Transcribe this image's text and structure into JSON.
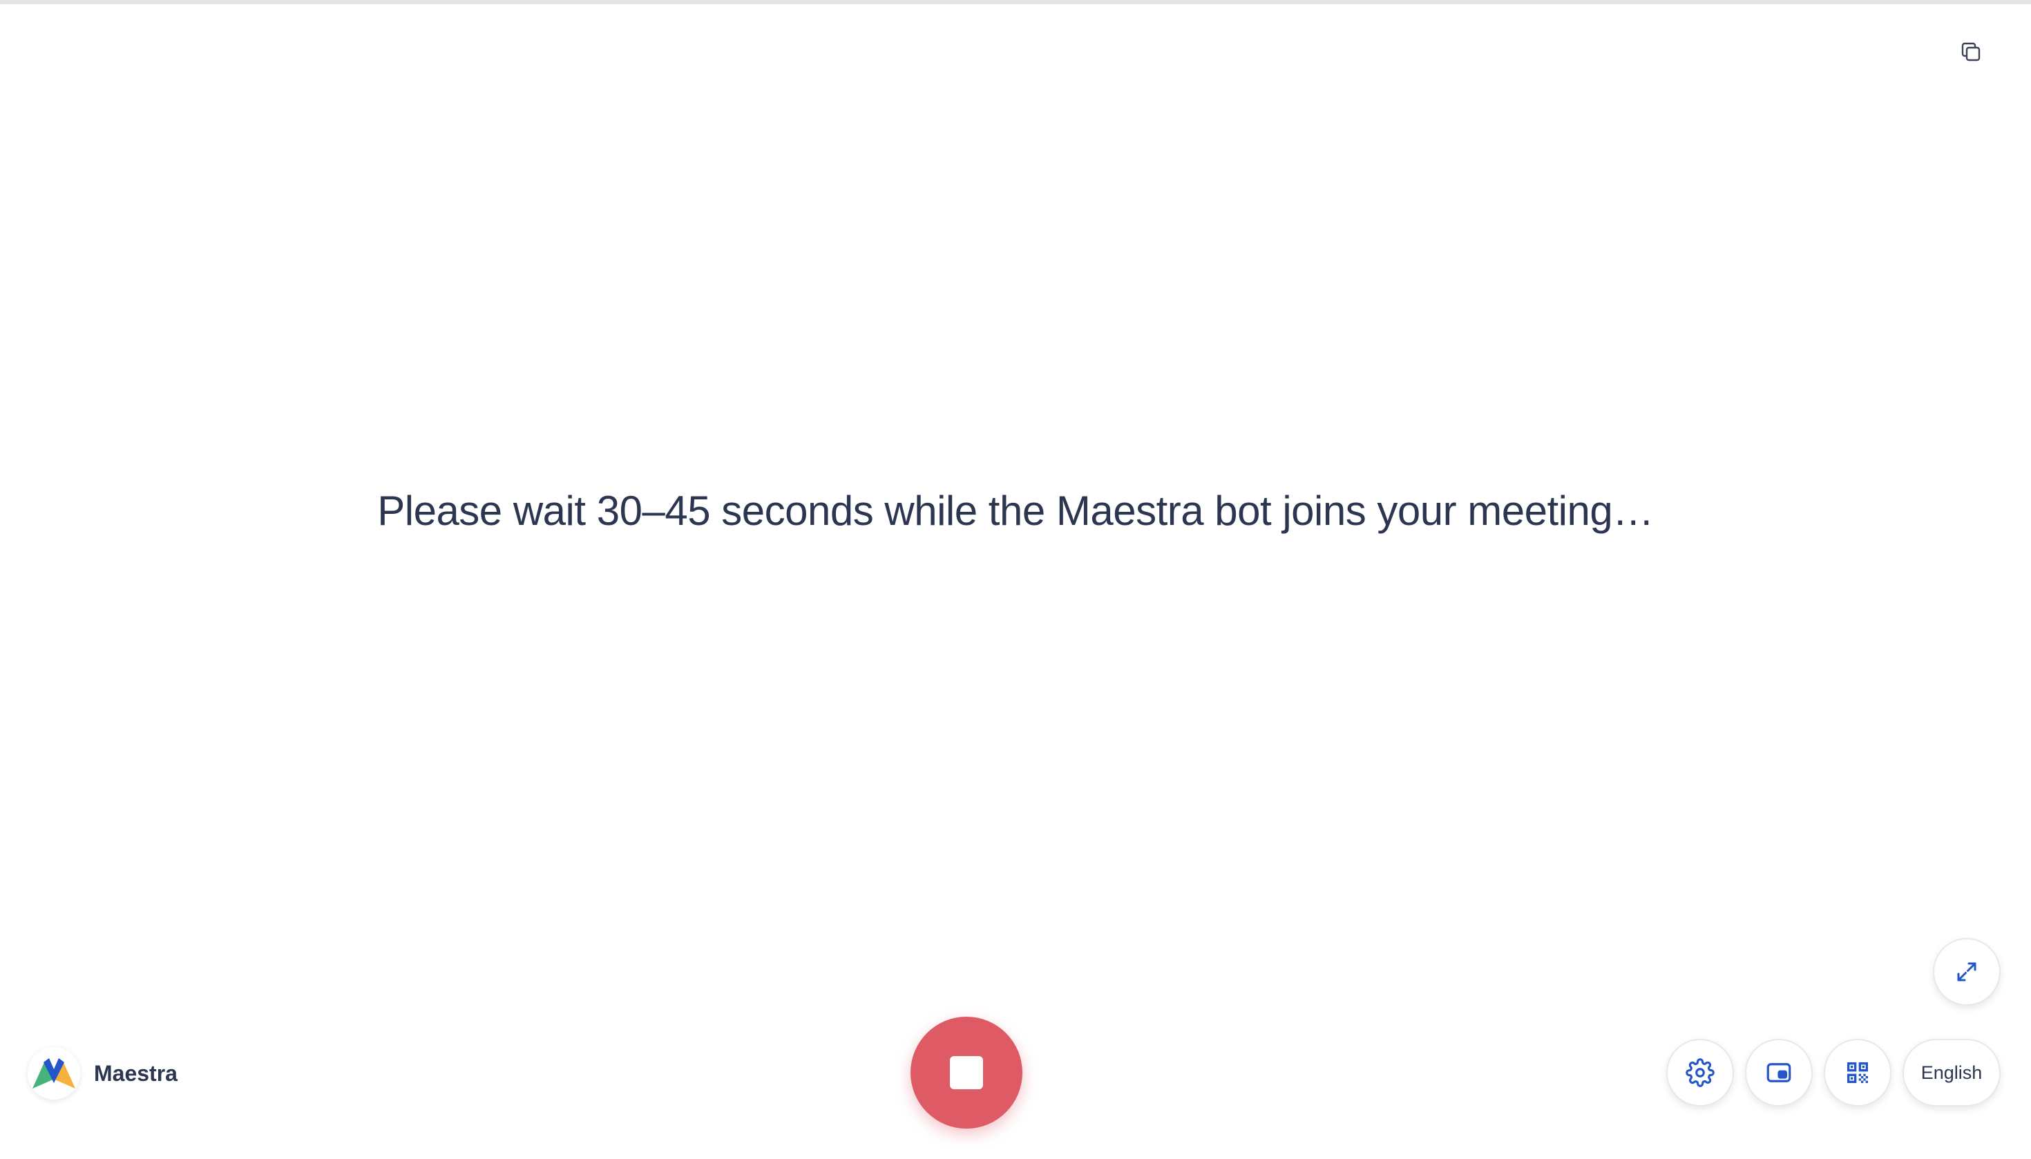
{
  "status": {
    "message": "Please wait 30–45 seconds while the Maestra bot joins your meeting…"
  },
  "brand": {
    "name": "Maestra",
    "logo_icon": "maestra-logo-icon"
  },
  "toolbar": {
    "copy_icon": "copy-icon",
    "expand_icon": "expand-icon",
    "stop_icon": "stop-icon",
    "settings_icon": "gear-icon",
    "pip_icon": "picture-in-picture-icon",
    "qr_icon": "qr-code-icon",
    "language_label": "English"
  },
  "colors": {
    "accent_blue": "#2456c9",
    "stop_red": "#de5a65",
    "text_dark": "#2c3650"
  }
}
